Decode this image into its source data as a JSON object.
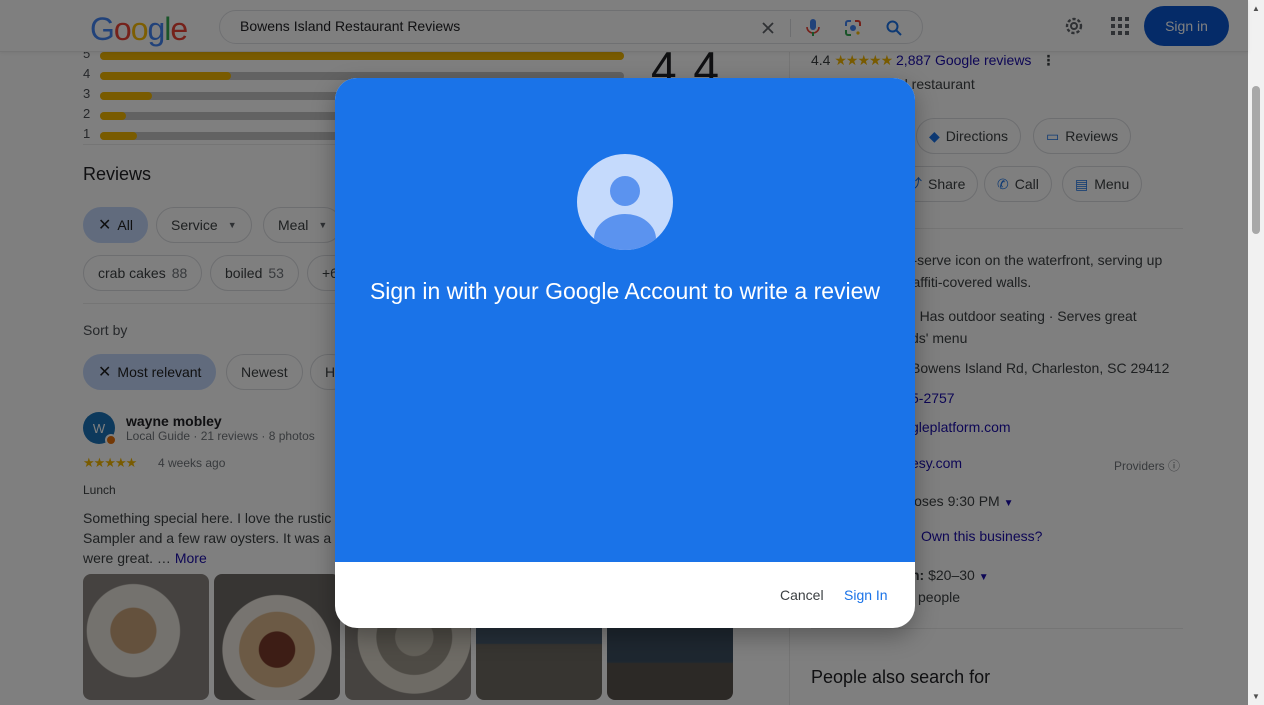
{
  "header": {
    "logo_letters": [
      "G",
      "o",
      "o",
      "g",
      "l",
      "e"
    ],
    "search_value": "Bowens Island Restaurant Reviews",
    "signin_label": "Sign in",
    "icons": [
      "clear-icon",
      "mic-icon",
      "lens-icon",
      "search-icon",
      "gear-icon",
      "apps-grid-icon"
    ]
  },
  "ratings": {
    "average": "4.4",
    "bars": [
      {
        "label": "5",
        "fraction": 1.0
      },
      {
        "label": "4",
        "fraction": 0.25
      },
      {
        "label": "3",
        "fraction": 0.1
      },
      {
        "label": "2",
        "fraction": 0.05
      },
      {
        "label": "1",
        "fraction": 0.07
      }
    ]
  },
  "reviews": {
    "heading": "Reviews",
    "filter_chips": [
      {
        "label": "All",
        "selected": true
      },
      {
        "label": "Service",
        "dropdown": true
      },
      {
        "label": "Meal",
        "dropdown": true
      }
    ],
    "topic_chips": [
      {
        "label": "crab cakes",
        "count": "88"
      },
      {
        "label": "boiled",
        "count": "53"
      },
      {
        "label": "+6",
        "count": ""
      }
    ],
    "sort_label": "Sort by",
    "sort_chips": [
      {
        "label": "Most relevant",
        "selected": true
      },
      {
        "label": "Newest"
      },
      {
        "label": "H"
      }
    ],
    "review": {
      "avatar_letter": "W",
      "name": "wayne mobley",
      "meta": "Local Guide · 21 reviews · 8 photos",
      "stars": "★★★★★",
      "date": "4 weeks ago",
      "meal": "Lunch",
      "text": "Something special here. I love the rustic Sampler and a few raw oysters. It was a they were great. …",
      "more": "More"
    }
  },
  "right_panel": {
    "rating": "4.4",
    "stars": "★★★★★",
    "review_count": "2,887 Google reviews",
    "category": "d restaurant",
    "buttons_row1": [
      "Directions",
      "Reviews"
    ],
    "buttons_row2": [
      "Share",
      "Call",
      "Menu"
    ],
    "description_1": "er-serve icon on the waterfront, serving up",
    "description_2": "graffiti-covered walls.",
    "service_label": ":",
    "service_1": "Has outdoor seating · Serves great",
    "service_2": "ds' menu",
    "address": "Bowens Island Rd, Charleston, SC 29412",
    "phone": "5-2757",
    "website": "gleplatform.com",
    "order": "esy.com",
    "providers": "Providers",
    "hours": "loses 9:30 PM",
    "own": "Own this business?",
    "price_label": "n:",
    "price": "$20–30",
    "price_people": "people",
    "people_also": "People also search for"
  },
  "dialog": {
    "title": "Sign in with your Google Account to write a review",
    "cancel": "Cancel",
    "signin": "Sign In",
    "colors": {
      "panel": "#1a73e8",
      "avatar_bg": "#c5dafc",
      "avatar_fg": "#5b93ef"
    }
  }
}
